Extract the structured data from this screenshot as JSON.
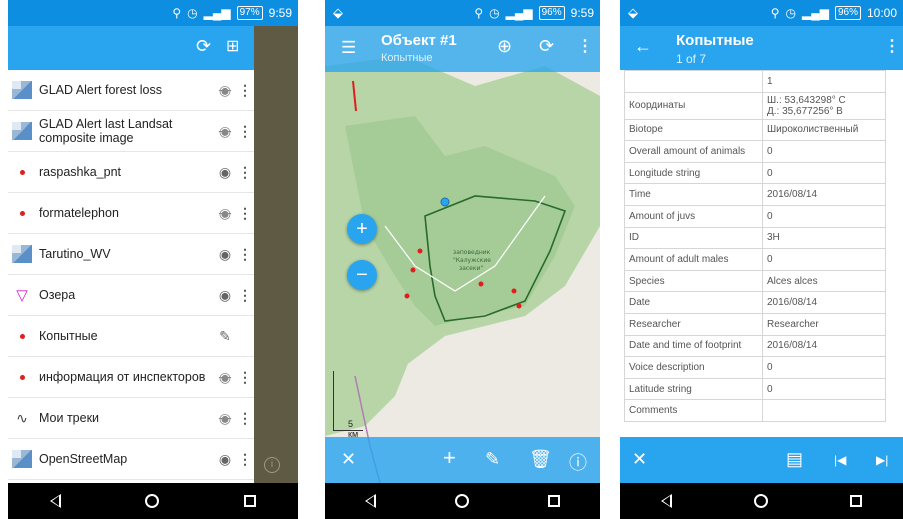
{
  "status": {
    "time1": "9:59",
    "time2": "9:59",
    "time3": "10:00",
    "battery1": "97%",
    "battery2": "96%",
    "battery3": "96%"
  },
  "colors": {
    "accent": "#29a5f0",
    "statusbar": "#0d8ee0",
    "point": "#e21d1d"
  },
  "layers": [
    {
      "name": "GLAD Alert forest loss",
      "icon": "raster-icon",
      "visibility": "hidden"
    },
    {
      "name": "GLAD Alert last Landsat composite image",
      "icon": "raster-icon",
      "visibility": "hidden"
    },
    {
      "name": "raspashka_pnt",
      "icon": "point-icon",
      "visibility": "visible"
    },
    {
      "name": "formatelephon",
      "icon": "point-icon",
      "visibility": "hidden"
    },
    {
      "name": "Tarutino_WV",
      "icon": "raster-icon",
      "visibility": "visible"
    },
    {
      "name": "Озера",
      "icon": "polygon-icon",
      "visibility": "visible"
    },
    {
      "name": "Копытные",
      "icon": "point-icon",
      "visibility": "editing"
    },
    {
      "name": "информация от инспекторов",
      "icon": "point-icon",
      "visibility": "hidden"
    },
    {
      "name": "Мои треки",
      "icon": "track-icon",
      "visibility": "hidden"
    },
    {
      "name": "OpenStreetMap",
      "icon": "raster-icon",
      "visibility": "visible"
    }
  ],
  "map": {
    "title": "Объект #1",
    "subtitle": "Копытные",
    "scale_label": "5 км",
    "reserve_label": "заповедник \"Калужские засеки\""
  },
  "attributes": {
    "title": "Копытные",
    "subtitle": "1 of 7",
    "rows": [
      {
        "key": "",
        "value": "1"
      },
      {
        "key": "Координаты",
        "value": "Ш.: 53,643298° С\nД.: 35,677256° В"
      },
      {
        "key": "Biotope",
        "value": "Широколиственный"
      },
      {
        "key": "Overall amount of animals",
        "value": "0"
      },
      {
        "key": "Longitude string",
        "value": "0"
      },
      {
        "key": "Time",
        "value": "2016/08/14"
      },
      {
        "key": "Amount of juvs",
        "value": "0"
      },
      {
        "key": "ID",
        "value": "3H"
      },
      {
        "key": "Amount of adult males",
        "value": "0"
      },
      {
        "key": "Species",
        "value": "Alces alces"
      },
      {
        "key": "Date",
        "value": "2016/08/14"
      },
      {
        "key": "Researcher",
        "value": "Researcher"
      },
      {
        "key": "Date and time of footprint",
        "value": "2016/08/14"
      },
      {
        "key": "Voice description",
        "value": "0"
      },
      {
        "key": "Latitude string",
        "value": "0"
      },
      {
        "key": "Comments",
        "value": ""
      }
    ]
  }
}
